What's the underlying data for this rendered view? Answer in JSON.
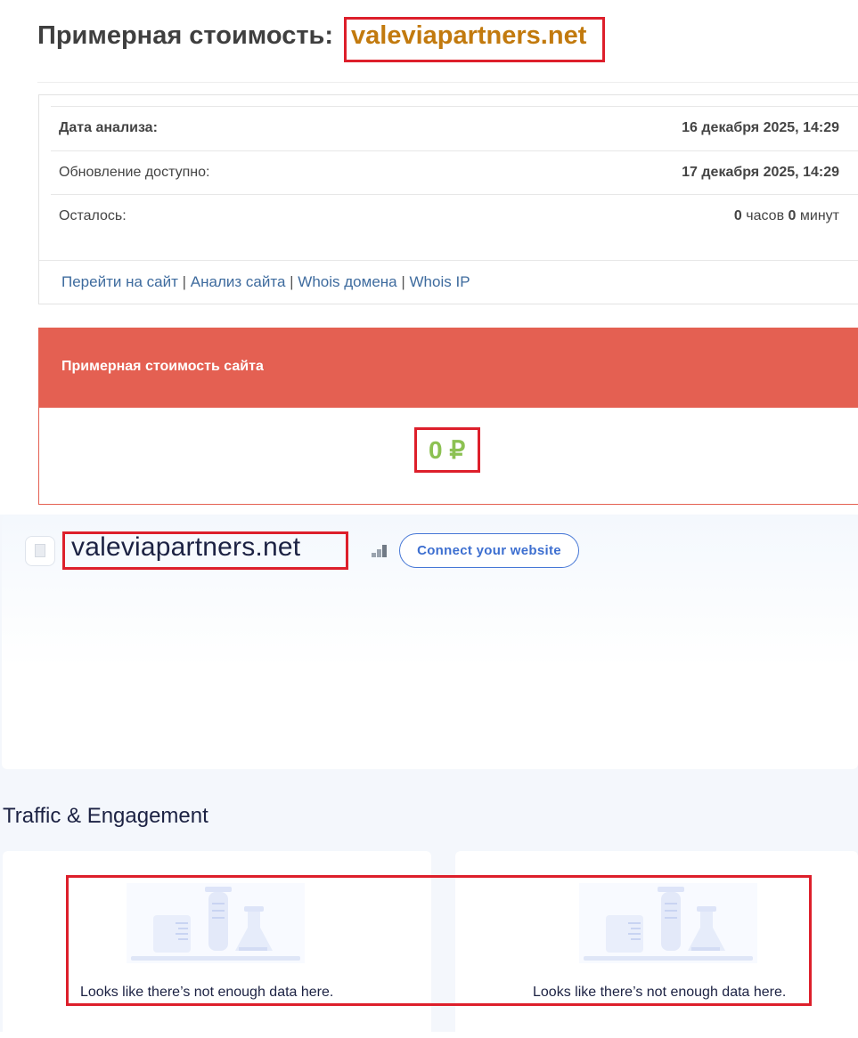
{
  "header": {
    "title_prefix": "Примерная стоимость:",
    "domain": "valeviapartners.net"
  },
  "analysis": {
    "rows": [
      {
        "label": "Дата анализа:",
        "value": "16 декабря 2025, 14:29"
      },
      {
        "label": "Обновление доступно:",
        "value": "17 декабря 2025, 14:29"
      },
      {
        "label": "Осталось:",
        "hours": "0",
        "hours_unit": "часов",
        "minutes": "0",
        "minutes_unit": "минут"
      }
    ],
    "links": [
      "Перейти на сайт",
      "Анализ сайта",
      "Whois домена",
      "Whois IP"
    ]
  },
  "cost": {
    "title": "Примерная стоимость сайта",
    "value": "0 ₽"
  },
  "similarweb": {
    "domain": "valeviapartners.net",
    "favicon_icon": "document-icon",
    "rank_icon": "signal-bars-icon",
    "connect_label": "Connect your website",
    "section_title": "Traffic & Engagement",
    "panels": [
      {
        "message": "Looks like there’s not enough data here.",
        "illustration": "lab-flasks-illustration"
      },
      {
        "message": "Looks like there’s not enough data here.",
        "illustration": "lab-flasks-illustration"
      }
    ]
  },
  "colors": {
    "domain_accent": "#c27a0e",
    "cost_header": "#e46052",
    "cost_value": "#8cc152",
    "link": "#3e6b9e",
    "connect_button": "#3d6fd0",
    "highlight_box": "#dd1f2b"
  }
}
